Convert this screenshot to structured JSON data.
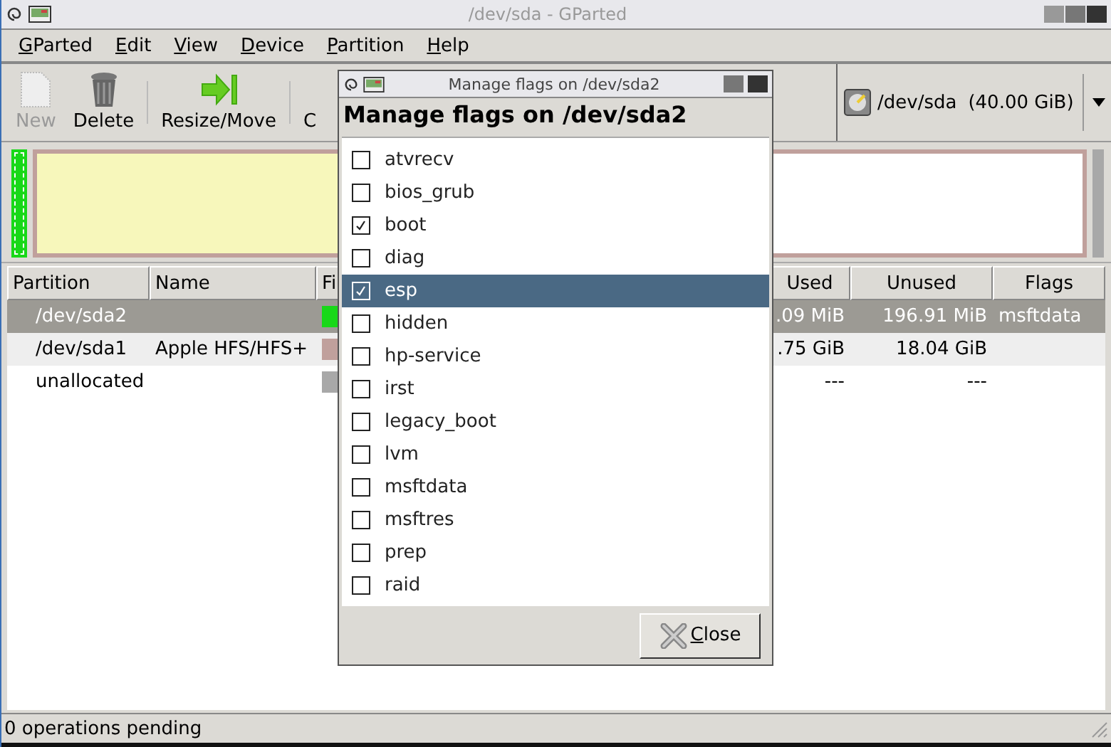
{
  "window": {
    "title": "/dev/sda - GParted"
  },
  "menu": [
    {
      "label": "GParted",
      "mnemonic_underlined": true
    },
    {
      "label": "Edit",
      "mnemonic_underlined": true
    },
    {
      "label": "View",
      "mnemonic_underlined": true
    },
    {
      "label": "Device",
      "mnemonic_underlined": true
    },
    {
      "label": "Partition",
      "mnemonic_underlined": true
    },
    {
      "label": "Help",
      "mnemonic_underlined": true
    }
  ],
  "toolbar": [
    {
      "kind": "new",
      "label": "New",
      "disabled": true
    },
    {
      "kind": "delete",
      "label": "Delete",
      "disabled": false
    },
    {
      "kind": "resize",
      "label": "Resize/Move",
      "disabled": false
    },
    {
      "kind": "copy",
      "label": "C",
      "disabled": false
    }
  ],
  "device": {
    "path": "/dev/sda",
    "size": "(40.00 GiB)"
  },
  "table": {
    "columns": [
      "Partition",
      "Name",
      "Fi",
      "Used",
      "Unused",
      "Flags"
    ],
    "rows": [
      {
        "partition": "/dev/sda2",
        "name": "",
        "color": "#18d818",
        "used": ".09 MiB",
        "unused": "196.91 MiB",
        "flags": "msftdata",
        "selected": true
      },
      {
        "partition": "/dev/sda1",
        "name": "Apple HFS/HFS+",
        "color": "#c0a09c",
        "used": ".75 GiB",
        "unused": "18.04 GiB",
        "flags": "",
        "selected": false
      },
      {
        "partition": "unallocated",
        "name": "",
        "color": "#a8a8a8",
        "used": "---",
        "unused": "---",
        "flags": "",
        "selected": false
      }
    ]
  },
  "status_bar": "0 operations pending",
  "dialog": {
    "title": "Manage flags on /dev/sda2",
    "heading": "Manage flags on /dev/sda2",
    "flags": [
      {
        "label": "atvrecv",
        "checked": false,
        "selected": false
      },
      {
        "label": "bios_grub",
        "checked": false,
        "selected": false
      },
      {
        "label": "boot",
        "checked": true,
        "selected": false
      },
      {
        "label": "diag",
        "checked": false,
        "selected": false
      },
      {
        "label": "esp",
        "checked": true,
        "selected": true
      },
      {
        "label": "hidden",
        "checked": false,
        "selected": false
      },
      {
        "label": "hp-service",
        "checked": false,
        "selected": false
      },
      {
        "label": "irst",
        "checked": false,
        "selected": false
      },
      {
        "label": "legacy_boot",
        "checked": false,
        "selected": false
      },
      {
        "label": "lvm",
        "checked": false,
        "selected": false
      },
      {
        "label": "msftdata",
        "checked": false,
        "selected": false
      },
      {
        "label": "msftres",
        "checked": false,
        "selected": false
      },
      {
        "label": "prep",
        "checked": false,
        "selected": false
      },
      {
        "label": "raid",
        "checked": false,
        "selected": false
      }
    ],
    "close": {
      "label": "Close",
      "mnemonic_underlined": true
    }
  }
}
